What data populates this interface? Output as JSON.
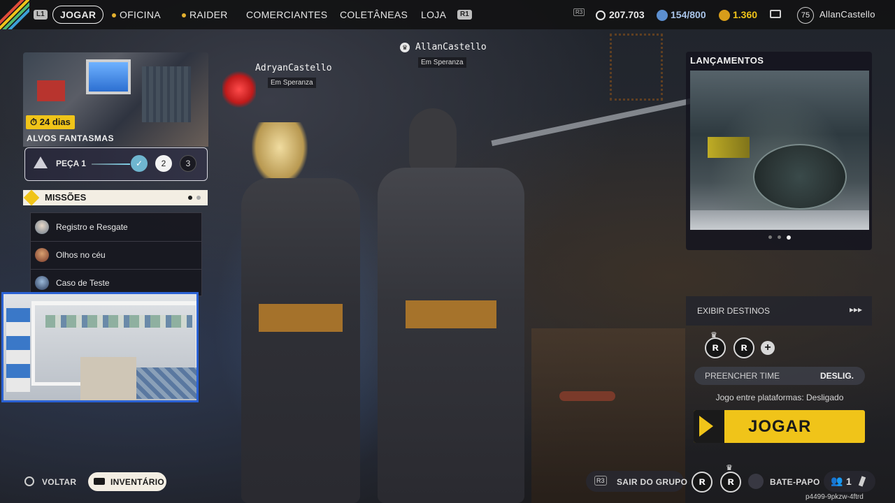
{
  "topbar": {
    "l1": "L1",
    "r1": "R1",
    "r3": "R3",
    "nav": [
      "JOGAR",
      "OFICINA",
      "RAIDER",
      "COMERCIANTES",
      "COLETÂNEAS",
      "LOJA"
    ],
    "credits": "207.703",
    "raider_tokens": "154/800",
    "coins": "1.360",
    "level": "75",
    "username": "AllanCastello"
  },
  "event_card": {
    "days": "24 dias",
    "title": "ALVOS FANTASMAS",
    "piece": "PEÇA 1",
    "steps": [
      "2",
      "3"
    ]
  },
  "missions": {
    "title": "MISSÕES",
    "items": [
      "Registro e Resgate",
      "Olhos no céu",
      "Caso de Teste"
    ]
  },
  "players": [
    {
      "name": "AdryanCastello",
      "location": "Em Speranza"
    },
    {
      "name": "AllanCastello",
      "location": "Em Speranza"
    }
  ],
  "releases": {
    "title": "LANÇAMENTOS"
  },
  "matchmaking": {
    "destinations": "EXIBIR DESTINOS",
    "arrows": "▸▸▸",
    "fill_team": "PREENCHER TIME",
    "fill_team_value": "DESLIG.",
    "crossplay": "Jogo entre plataformas: Desligado",
    "play": "JOGAR"
  },
  "bottom": {
    "back": "VOLTAR",
    "inventory": "INVENTÁRIO",
    "leave_key": "R3",
    "leave_group": "SAIR DO GRUPO",
    "chat": "BATE-PAPO",
    "party_count": "1"
  },
  "watermark": "p4499-9pkzw-4ftrd",
  "colors": {
    "accent_yellow": "#f0c419",
    "cream": "#f3eee3",
    "webcam_border": "#2b62d4"
  }
}
